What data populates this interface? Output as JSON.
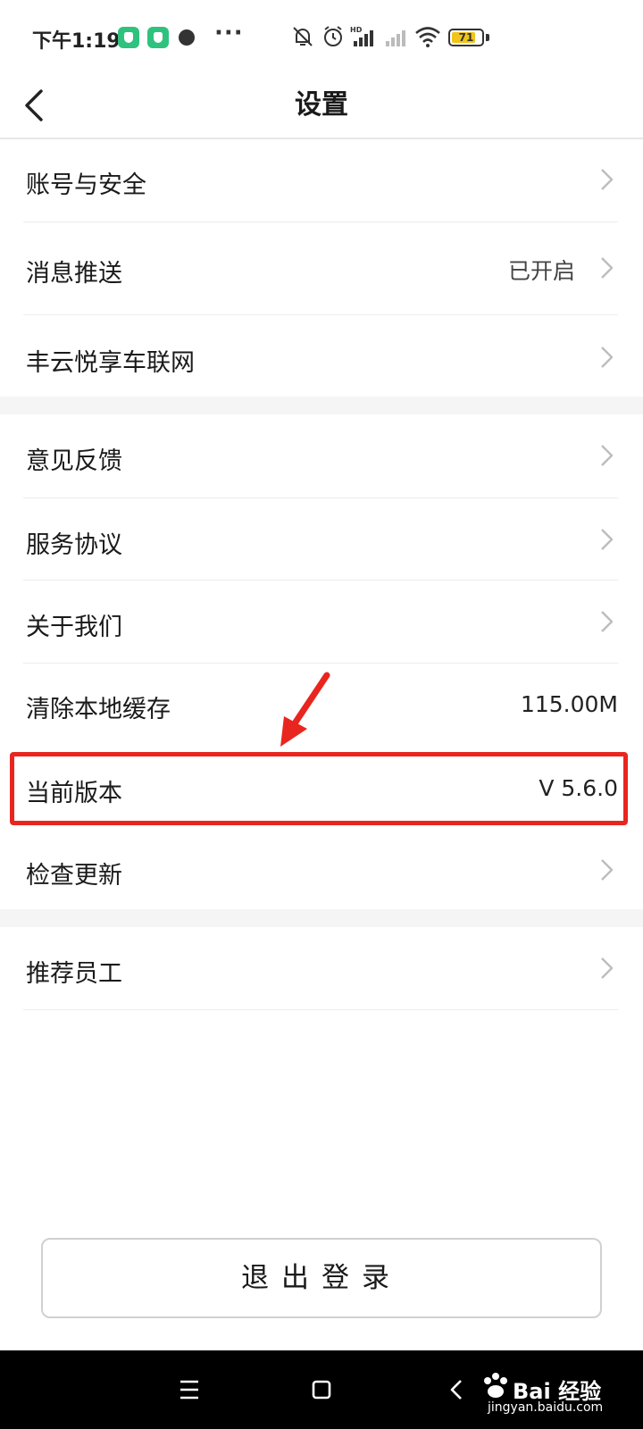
{
  "status_bar": {
    "time": "下午1:19",
    "battery_level": "71",
    "colors": {
      "app_badge": "#2ec27e",
      "battery_fill": "#f0c419"
    },
    "icons": [
      "app-badge-icon",
      "app-badge-icon",
      "record-dot-icon",
      "more-dots-icon",
      "mute-bell-icon",
      "alarm-icon",
      "signal-hd-icon",
      "signal-weak-icon",
      "wifi-icon",
      "battery-icon"
    ]
  },
  "header": {
    "title": "设置",
    "back_icon": "chevron-left-icon"
  },
  "settings": {
    "group1": [
      {
        "label": "账号与安全",
        "value": ""
      },
      {
        "label": "消息推送",
        "value": "已开启"
      },
      {
        "label": "丰云悦享车联网",
        "value": ""
      }
    ],
    "group2": [
      {
        "label": "意见反馈",
        "value": ""
      },
      {
        "label": "服务协议",
        "value": ""
      },
      {
        "label": "关于我们",
        "value": ""
      },
      {
        "label": "清除本地缓存",
        "value": "115.00M"
      },
      {
        "label": "当前版本",
        "value": "V 5.6.0"
      },
      {
        "label": "检查更新",
        "value": ""
      }
    ],
    "group3": [
      {
        "label": "推荐员工",
        "value": ""
      }
    ]
  },
  "annotation": {
    "highlight_color": "#e8261f"
  },
  "logout": {
    "label": "退出登录"
  },
  "nav_bar": {
    "icons": [
      "menu-icon",
      "home-square-icon",
      "back-chevron-icon"
    ]
  },
  "watermark": {
    "text": "Bai 经验",
    "url": "jingyan.baidu.com"
  }
}
